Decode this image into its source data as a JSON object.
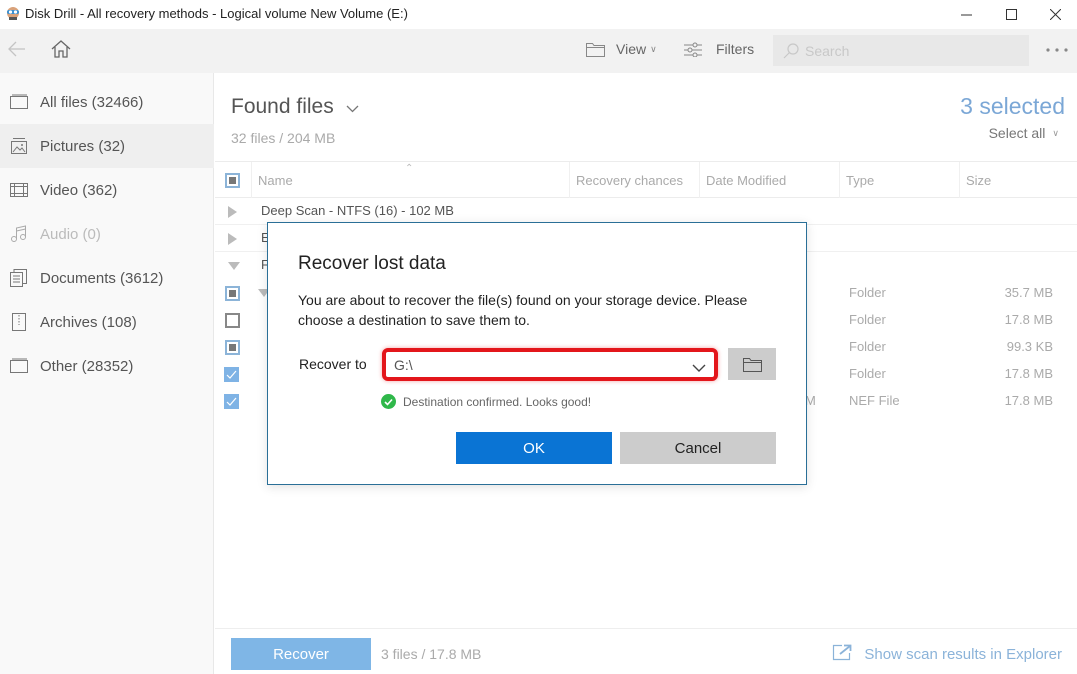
{
  "window": {
    "title": "Disk Drill - All recovery methods - Logical volume New Volume (E:)",
    "app_icon": "disk-drill-icon",
    "controls": [
      "minimize-icon",
      "maximize-icon",
      "close-icon"
    ]
  },
  "toolbar": {
    "back_icon": "arrow-left-icon",
    "home_icon": "home-icon",
    "view_label": "View",
    "filters_label": "Filters",
    "search_placeholder": "Search",
    "search_value": "",
    "more_icon": "more-horizontal-icon"
  },
  "sidebar": {
    "items": [
      {
        "label": "All files (32466)",
        "icon": "all-files-icon",
        "active": false,
        "disabled": false
      },
      {
        "label": "Pictures (32)",
        "icon": "picture-icon",
        "active": true,
        "disabled": false
      },
      {
        "label": "Video (362)",
        "icon": "video-icon",
        "active": false,
        "disabled": false
      },
      {
        "label": "Audio (0)",
        "icon": "audio-icon",
        "active": false,
        "disabled": true
      },
      {
        "label": "Documents (3612)",
        "icon": "documents-icon",
        "active": false,
        "disabled": false
      },
      {
        "label": "Archives (108)",
        "icon": "archive-icon",
        "active": false,
        "disabled": false
      },
      {
        "label": "Other (28352)",
        "icon": "other-icon",
        "active": false,
        "disabled": false
      }
    ]
  },
  "main": {
    "title": "Found files",
    "subtitle": "32 files / 204 MB",
    "selected": "3 selected",
    "select_all": "Select all",
    "columns": [
      "Name",
      "Recovery chances",
      "Date Modified",
      "Type",
      "Size"
    ],
    "rows": [
      {
        "name": "Deep Scan - NTFS (16) - 102 MB",
        "expander": "collapsed",
        "checkbox": null,
        "date": "",
        "type": "",
        "size": ""
      },
      {
        "name": "E",
        "expander": "collapsed",
        "checkbox": null,
        "date": "",
        "type": "",
        "size": ""
      },
      {
        "name": "F",
        "expander": "expanded",
        "checkbox": null,
        "date": "",
        "type": "",
        "size": ""
      },
      {
        "name": "",
        "expander": "expanded-sub",
        "checkbox": "partial",
        "date": "",
        "type": "Folder",
        "size": "35.7 MB"
      },
      {
        "name": "",
        "expander": null,
        "checkbox": "empty",
        "date": "",
        "type": "Folder",
        "size": "17.8 MB"
      },
      {
        "name": "",
        "expander": null,
        "checkbox": "partial",
        "date": "",
        "type": "Folder",
        "size": "99.3 KB"
      },
      {
        "name": "",
        "expander": null,
        "checkbox": "checked",
        "date": "",
        "type": "Folder",
        "size": "17.8 MB"
      },
      {
        "name": "",
        "expander": null,
        "checkbox": "checked",
        "date": "M",
        "type": "NEF File",
        "size": "17.8 MB"
      }
    ]
  },
  "bottom": {
    "recover_label": "Recover",
    "recover_info": "3 files / 17.8 MB",
    "explorer_link": "Show scan results in Explorer"
  },
  "dialog": {
    "title": "Recover lost data",
    "message": "You are about to recover the file(s) found on your storage device. Please choose a destination to save them to.",
    "recover_to_label": "Recover to",
    "destination": "G:\\",
    "confirmation": "Destination confirmed. Looks good!",
    "ok_label": "OK",
    "cancel_label": "Cancel",
    "highlight_color": "#e3161b",
    "ok_color": "#0a74d4"
  }
}
